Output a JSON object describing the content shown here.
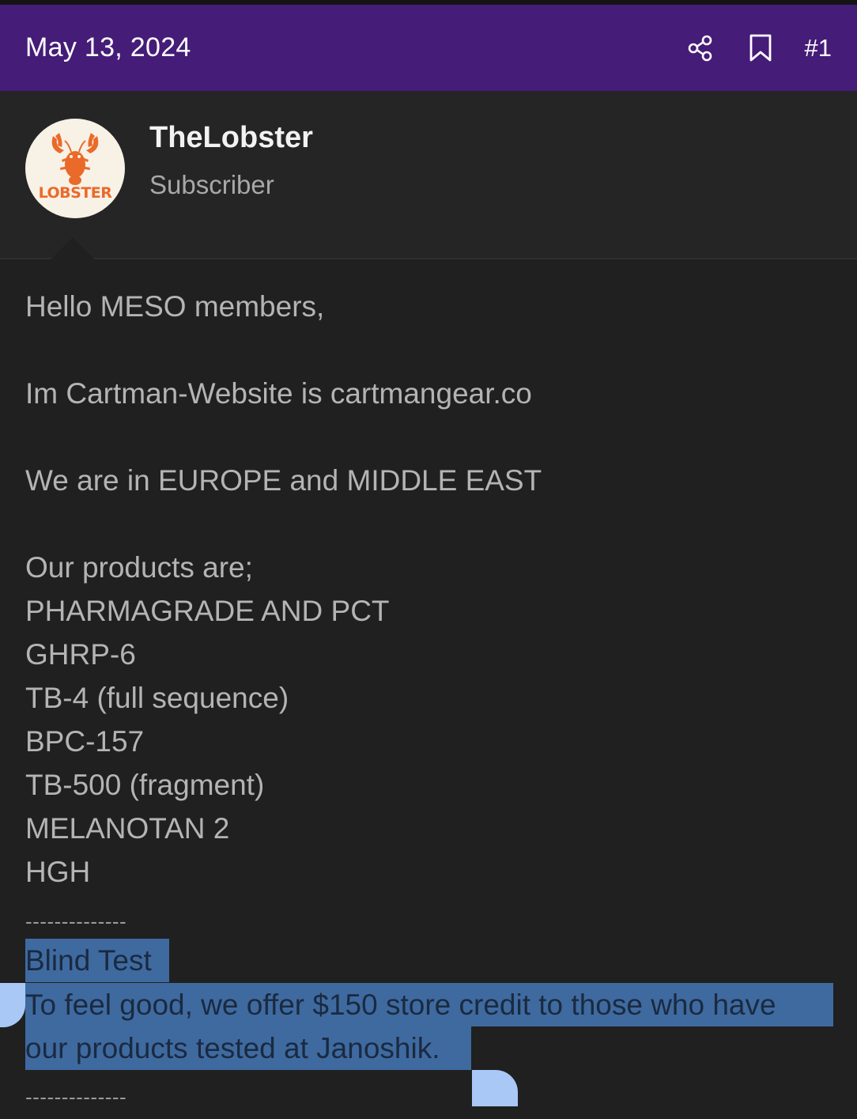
{
  "post": {
    "date": "May 13, 2024",
    "number": "#1",
    "share_icon": "share-icon",
    "bookmark_icon": "bookmark-icon"
  },
  "author": {
    "name": "TheLobster",
    "title": "Subscriber",
    "avatar_text": "LOBSTER"
  },
  "body": {
    "lines": [
      "Hello MESO members,",
      "Im Cartman-Website is cartmangear.co",
      "We are in EUROPE and MIDDLE EAST",
      "Our products are;",
      "PHARMAGRADE AND PCT",
      "GHRP-6",
      "TB-4 (full sequence)",
      "BPC-157",
      "TB-500 (fragment)",
      "MELANOTAN 2",
      "HGH",
      "--------------",
      "Blind Test",
      "To feel good, we offer $150 store credit to those who have",
      "our products tested at Janoshik.",
      "--------------"
    ]
  },
  "colors": {
    "header_bg": "#451c78",
    "page_bg": "#202020",
    "selection": "#3f6aa0",
    "avatar_accent": "#ea6a2a"
  }
}
